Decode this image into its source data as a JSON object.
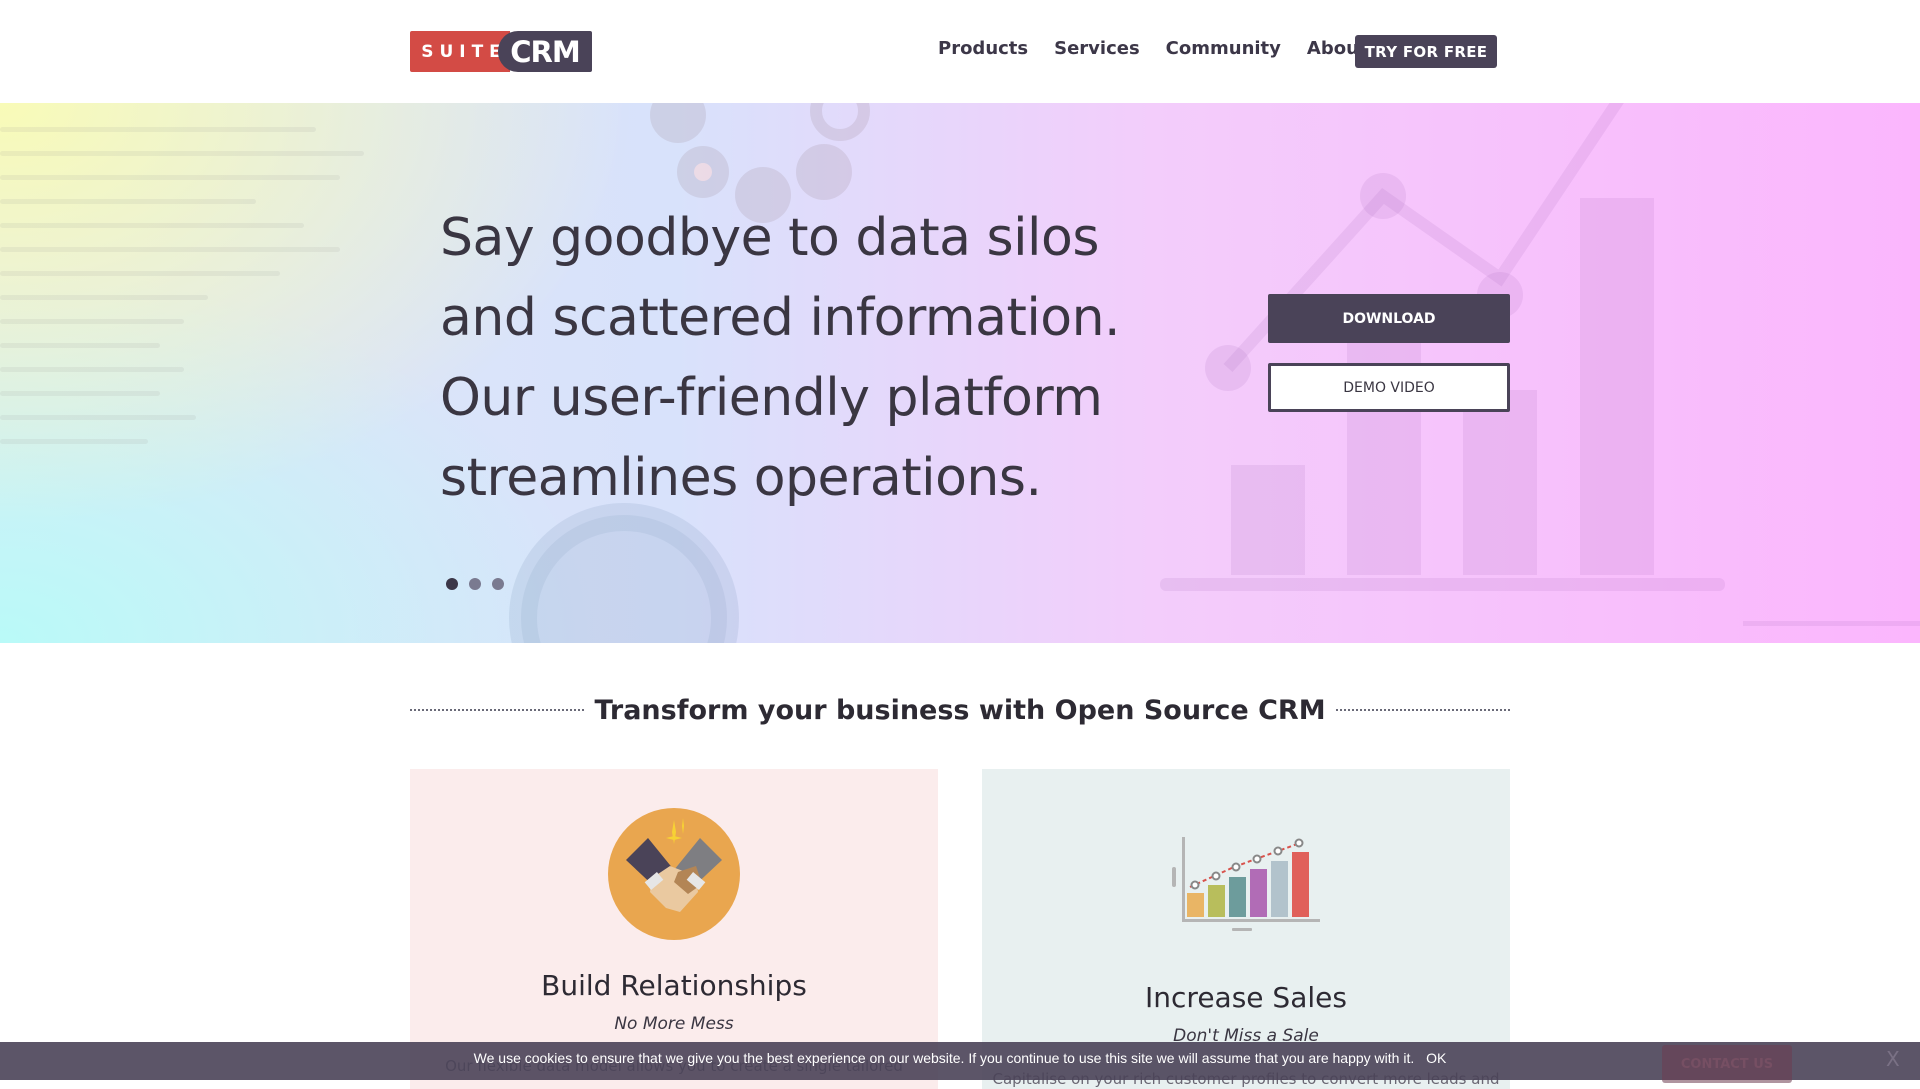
{
  "header": {
    "logo": {
      "suite": "SUITE",
      "crm": "CRM"
    },
    "nav": [
      "Products",
      "Services",
      "Community",
      "About"
    ],
    "cta": "TRY FOR FREE"
  },
  "hero": {
    "title_lines": [
      "Say goodbye to data silos",
      "and scattered information.",
      "Our user-friendly platform",
      "streamlines operations."
    ],
    "download_label": "DOWNLOAD",
    "demo_label": "DEMO VIDEO",
    "carousel": {
      "slides": 3,
      "active_index": 0
    }
  },
  "section": {
    "title": "Transform your business with Open Source CRM"
  },
  "cards": [
    {
      "icon": "handshake-icon",
      "title": "Build Relationships",
      "subtitle": "No More Mess",
      "body": "Our flexible data model allows you to create a single tailored"
    },
    {
      "icon": "sales-chart-icon",
      "title": "Increase Sales",
      "subtitle": "Don't Miss a Sale",
      "body": "Capitalise on your rich customer profiles to convert more leads and"
    }
  ],
  "cookie": {
    "text": "We use cookies to ensure that we give you the best experience on our website. If you continue to use this site we will assume that you are happy with it.",
    "ok_label": "OK"
  },
  "contact_label": "CONTACT US",
  "close_label": "X",
  "colors": {
    "brand_red": "#d34b45",
    "brand_dark": "#4a4358",
    "card_pink": "#fbecec",
    "card_teal": "#e8f0f0"
  }
}
